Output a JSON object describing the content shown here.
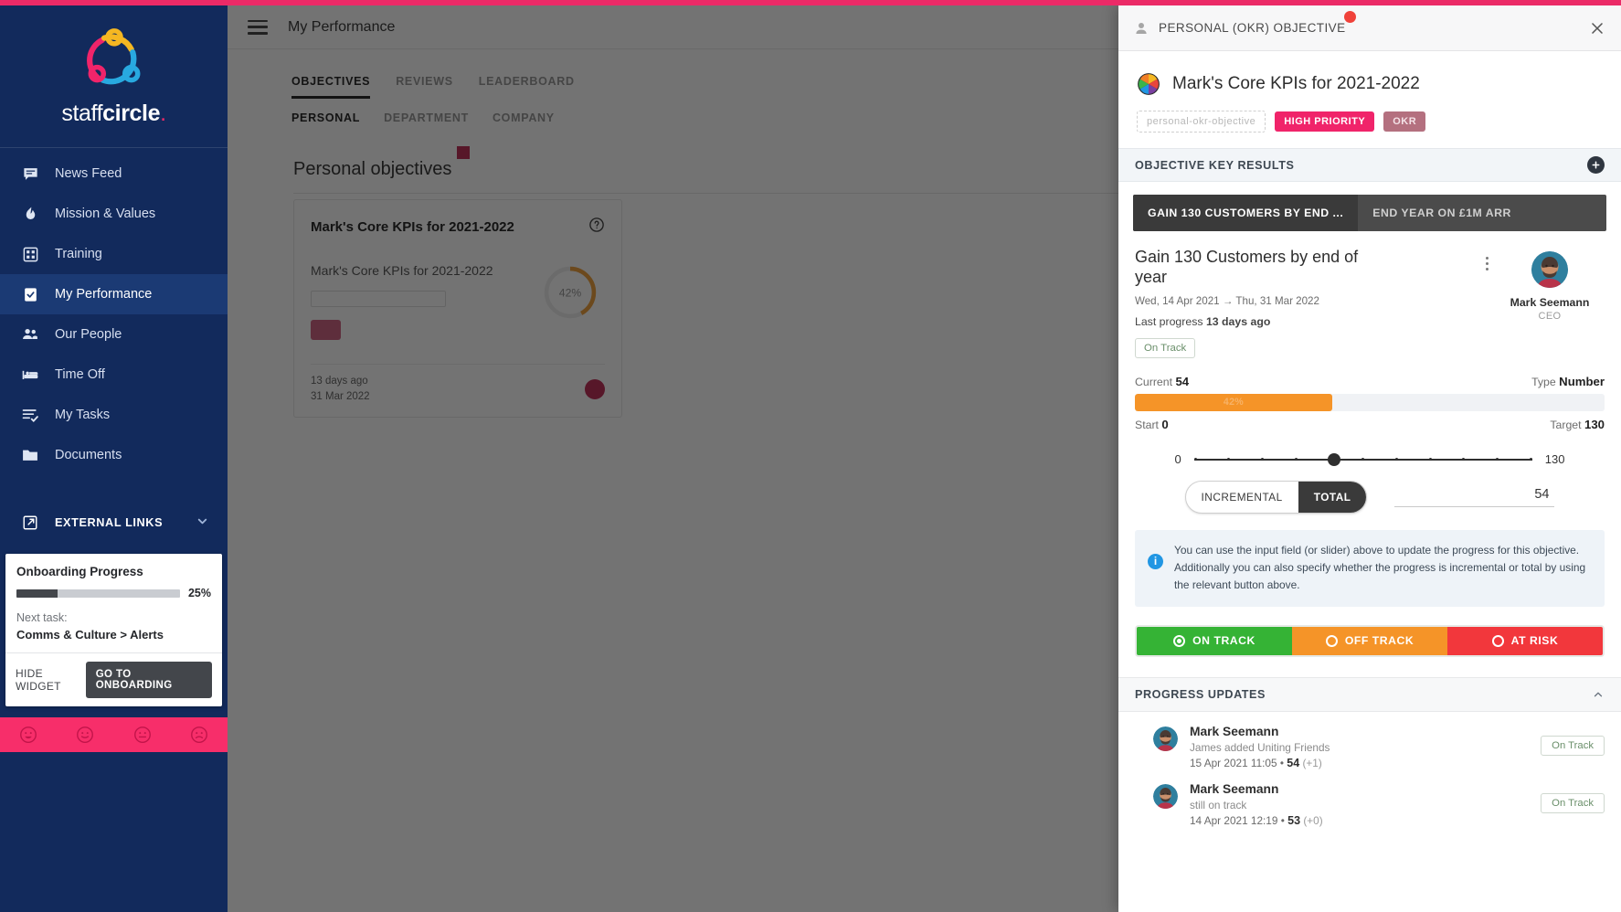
{
  "brand": {
    "name_thin": "staff",
    "name_bold": "circle",
    "accent": "#eb2a67",
    "sidebar_bg": "#122a5c"
  },
  "sidebar": {
    "items": [
      {
        "label": "News Feed",
        "icon": "news-feed-icon",
        "active": false
      },
      {
        "label": "Mission & Values",
        "icon": "mission-values-icon",
        "active": false
      },
      {
        "label": "Training",
        "icon": "training-icon",
        "active": false
      },
      {
        "label": "My Performance",
        "icon": "my-performance-icon",
        "active": true
      },
      {
        "label": "Our People",
        "icon": "our-people-icon",
        "active": false
      },
      {
        "label": "Time Off",
        "icon": "time-off-icon",
        "active": false
      },
      {
        "label": "My Tasks",
        "icon": "my-tasks-icon",
        "active": false
      },
      {
        "label": "Documents",
        "icon": "documents-icon",
        "active": false
      }
    ],
    "external_links": {
      "label": "EXTERNAL LINKS",
      "icon": "external-link-icon",
      "chevron": "chevron-down-icon"
    },
    "onboarding": {
      "title": "Onboarding Progress",
      "percent_label": "25%",
      "percent_value": 25,
      "next_task_label": "Next task:",
      "next_task": "Comms & Culture > Alerts",
      "hide_label": "HIDE WIDGET",
      "go_label": "GO TO ONBOARDING"
    },
    "mood_bar": {
      "bg": "#f72e6a",
      "moods": [
        "very-happy",
        "happy",
        "neutral",
        "sad"
      ]
    }
  },
  "main": {
    "title": "My Performance",
    "menu_icon": "hamburger-icon",
    "tabs_primary": [
      {
        "label": "OBJECTIVES",
        "active": true
      },
      {
        "label": "REVIEWS",
        "active": false
      },
      {
        "label": "LEADERBOARD",
        "active": false
      }
    ],
    "tabs_secondary": [
      {
        "label": "PERSONAL",
        "active": true
      },
      {
        "label": "DEPARTMENT",
        "active": false
      },
      {
        "label": "COMPANY",
        "active": false
      }
    ],
    "section_title": "Personal objectives",
    "card": {
      "title": "Mark's Core KPIs for 2021-2022",
      "subtitle": "Mark's Core KPIs for 2021-2022",
      "ring_label": "42%",
      "date_relative": "13 days ago",
      "date_due": "31 Mar 2022",
      "help_icon": "help-icon"
    }
  },
  "panel": {
    "header": {
      "title": "PERSONAL (OKR) OBJECTIVE",
      "person_icon": "person-icon",
      "close_icon": "close-icon",
      "badge": true
    },
    "objective": {
      "title": "Mark's Core KPIs for 2021-2022",
      "emoji": "color-wheel-icon",
      "chips": [
        {
          "label": "personal-okr-objective",
          "style": "ghost"
        },
        {
          "label": "HIGH PRIORITY",
          "style": "hot"
        },
        {
          "label": "OKR",
          "style": "okr"
        }
      ]
    },
    "key_results_section": {
      "title": "OBJECTIVE KEY RESULTS",
      "add_icon": "plus-icon",
      "add_label": "+"
    },
    "kr_tabs": [
      {
        "label": "GAIN 130 CUSTOMERS BY END ...",
        "active": true
      },
      {
        "label": "END YEAR ON £1M ARR",
        "active": false
      }
    ],
    "key_result": {
      "name": "Gain 130 Customers by end of year",
      "dates": "Wed, 14 Apr 2021 → Thu, 31 Mar 2022",
      "last_progress_label": "Last progress",
      "last_progress_value": "13 days ago",
      "status_badge": "On Track",
      "kebab_icon": "more-vertical-icon",
      "owner": {
        "name": "Mark Seemann",
        "role": "CEO",
        "avatar": "user-avatar"
      },
      "progress": {
        "current_label": "Current",
        "current_value": "54",
        "type_label": "Type",
        "type_value": "Number",
        "percent_label": "42%",
        "percent_value": 42,
        "start_label": "Start",
        "start_value": "0",
        "target_label": "Target",
        "target_value": "130"
      },
      "slider": {
        "min": "0",
        "max": "130",
        "value": 54,
        "ticks": 11
      },
      "mode_toggle": [
        {
          "label": "INCREMENTAL",
          "active": false
        },
        {
          "label": "TOTAL",
          "active": true
        }
      ],
      "input_value": "54",
      "info_icon": "info-icon",
      "info_text": "You can use the input field (or slider) above to update the progress for this objective. Additionally you can also specify whether the progress is incremental or total by using the relevant button above.",
      "status_buttons": [
        {
          "label": "ON TRACK",
          "color": "#35b335",
          "selected": true
        },
        {
          "label": "OFF TRACK",
          "color": "#f59428",
          "selected": false
        },
        {
          "label": "AT RISK",
          "color": "#f2373c",
          "selected": false
        }
      ]
    },
    "progress_updates": {
      "title": "PROGRESS UPDATES",
      "collapse_icon": "chevron-up-icon",
      "items": [
        {
          "name": "Mark Seemann",
          "note": "James added Uniting Friends",
          "timestamp": "15 Apr 2021 11:05",
          "value": "54",
          "delta": "(+1)",
          "badge": "On Track"
        },
        {
          "name": "Mark Seemann",
          "note": "still on track",
          "timestamp": "14 Apr 2021 12:19",
          "value": "53",
          "delta": "(+0)",
          "badge": "On Track"
        }
      ]
    }
  }
}
